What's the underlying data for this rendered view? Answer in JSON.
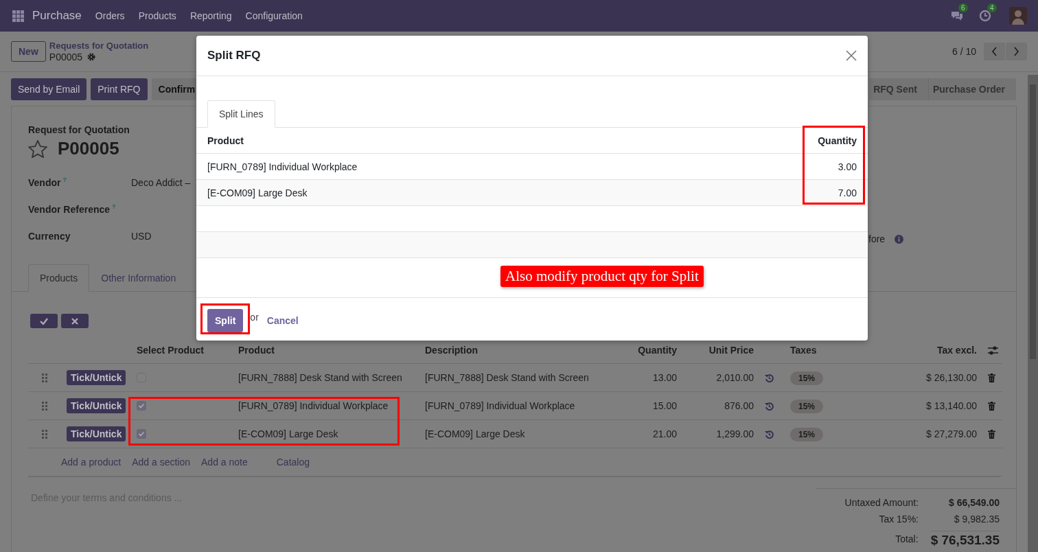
{
  "navbar": {
    "app": "Purchase",
    "menus": [
      "Orders",
      "Products",
      "Reporting",
      "Configuration"
    ],
    "messages_count": "6",
    "activities_count": "4"
  },
  "control_panel": {
    "new_button": "New",
    "breadcrumb": "Requests for Quotation",
    "record": "P00005",
    "pager": "6 / 10"
  },
  "actions": [
    {
      "label": "Send by Email",
      "kind": "primary"
    },
    {
      "label": "Print RFQ",
      "kind": "primary"
    },
    {
      "label": "Confirm",
      "kind": "secondary"
    }
  ],
  "status_bar": [
    {
      "label": "RFQ Sent",
      "selected": false
    },
    {
      "label": "Purchase Order",
      "selected": false
    }
  ],
  "form": {
    "caption": "Request for Quotation",
    "title": "P00005",
    "starred": false,
    "fields": [
      {
        "label": "Vendor",
        "help_mark": "?",
        "value": "Deco Addict –"
      },
      {
        "label": "Vendor Reference",
        "help_mark": "?"
      },
      {
        "label": "Currency",
        "value": "USD"
      }
    ],
    "right_fragment": "fore",
    "tabs": [
      {
        "label": "Products",
        "selected": true
      },
      {
        "label": "Other Information",
        "selected": false
      }
    ],
    "table": {
      "columns": [
        "Select Product",
        "Product",
        "Description",
        "Quantity",
        "Unit Price",
        "Taxes",
        "Tax excl."
      ],
      "rows": [
        {
          "tick_button": "Tick/Untick",
          "checked": false,
          "product": "[FURN_7888] Desk Stand with Screen",
          "description": "[FURN_7888] Desk Stand with Screen",
          "quantity": "13.00",
          "unit_price": "2,010.00",
          "tax": "15%",
          "subtotal": "$ 26,130.00"
        },
        {
          "tick_button": "Tick/Untick",
          "checked": true,
          "product": "[FURN_0789] Individual Workplace",
          "description": "[FURN_0789] Individual Workplace",
          "quantity": "15.00",
          "unit_price": "876.00",
          "tax": "15%",
          "subtotal": "$ 13,140.00"
        },
        {
          "tick_button": "Tick/Untick",
          "checked": true,
          "product": "[E-COM09] Large Desk",
          "description": "[E-COM09] Large Desk",
          "quantity": "21.00",
          "unit_price": "1,299.00",
          "tax": "15%",
          "subtotal": "$ 27,279.00"
        }
      ],
      "add_links": [
        "Add a product",
        "Add a section",
        "Add a note",
        "Catalog"
      ]
    },
    "terms_placeholder": "Define your terms and conditions ...",
    "totals": [
      {
        "label": "Untaxed Amount:",
        "value": "$ 66,549.00",
        "kind": "subtotal"
      },
      {
        "label": "Tax 15%:",
        "value": "$ 9,982.35",
        "kind": "tax"
      },
      {
        "label": "Total:",
        "value": "$ 76,531.35",
        "kind": "total"
      }
    ]
  },
  "dialog": {
    "title": "Split RFQ",
    "tabs": [
      {
        "label": "Split Lines",
        "selected": true
      }
    ],
    "columns": [
      "Product",
      "Quantity"
    ],
    "rows": [
      {
        "product": "[FURN_0789] Individual Workplace",
        "quantity": "3.00"
      },
      {
        "product": "[E-COM09] Large Desk",
        "quantity": "7.00"
      }
    ],
    "callout": "Also modify product qty for Split",
    "buttons": [
      {
        "label": "Split",
        "kind": "primary"
      },
      {
        "label": "Cancel",
        "kind": "link"
      }
    ],
    "separator": "or"
  }
}
